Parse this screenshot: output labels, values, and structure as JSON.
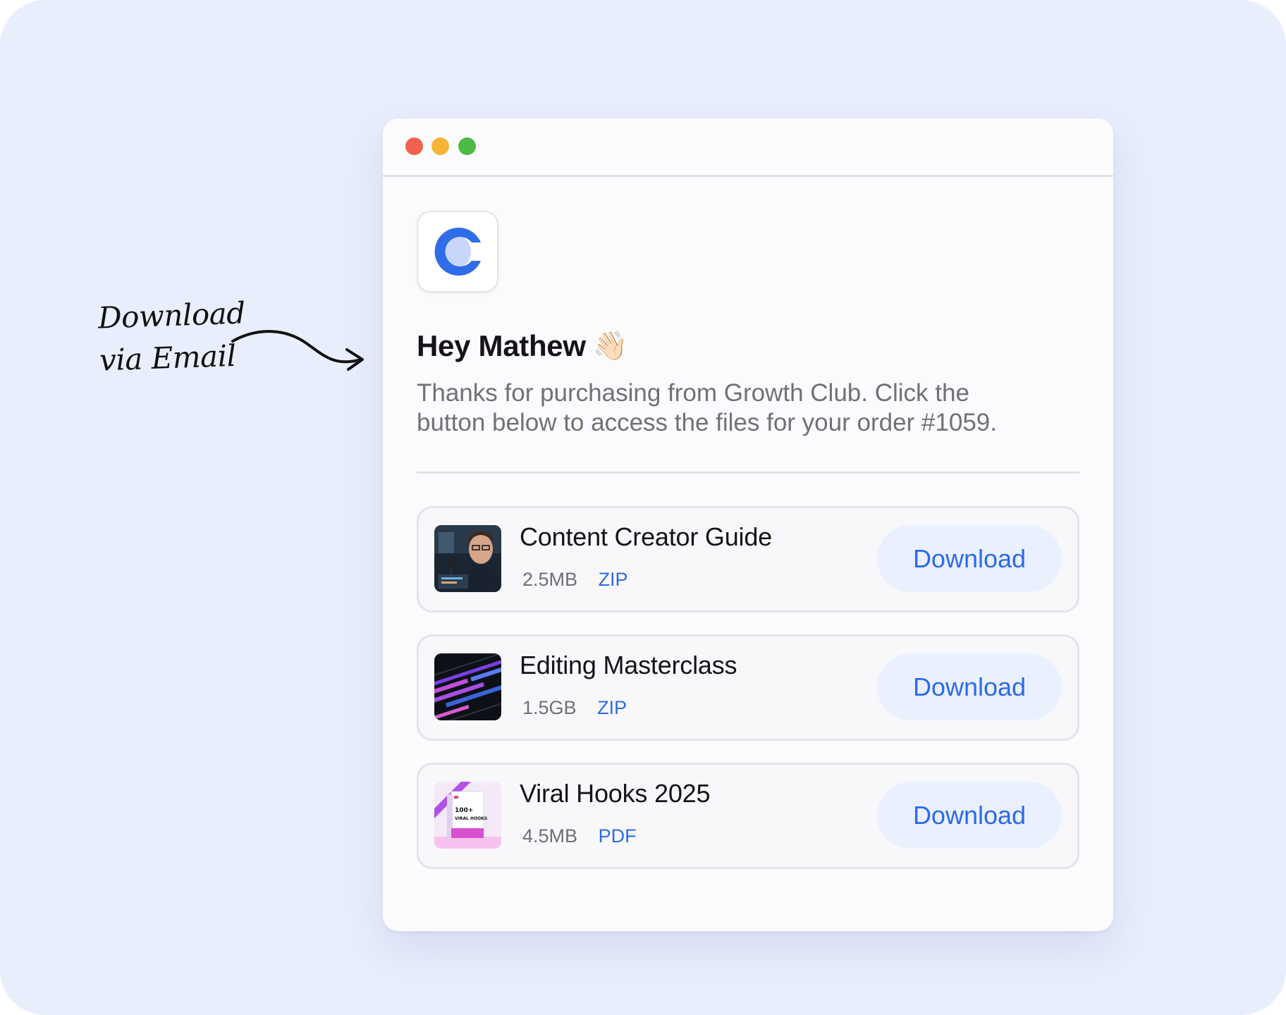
{
  "annotation": {
    "line1": "Download",
    "line2": "via Email"
  },
  "window": {
    "traffic_lights": [
      "close",
      "minimize",
      "zoom"
    ]
  },
  "email": {
    "logo_icon": "growth-club-logo-icon",
    "greeting": "Hey Mathew",
    "wave_emoji": "👋🏻",
    "message": "Thanks for purchasing from Growth Club. Click the button below to access the files for your order #1059."
  },
  "files": [
    {
      "title": "Content Creator Guide",
      "size": "2.5MB",
      "type": "ZIP",
      "button": "Download",
      "thumbnail": "podcast-creator-thumbnail"
    },
    {
      "title": "Editing Masterclass",
      "size": "1.5GB",
      "type": "ZIP",
      "button": "Download",
      "thumbnail": "editing-timeline-thumbnail"
    },
    {
      "title": "Viral Hooks 2025",
      "size": "4.5MB",
      "type": "PDF",
      "button": "Download",
      "thumbnail": "viral-hooks-book-thumbnail"
    }
  ],
  "colors": {
    "background": "#e9eefd",
    "accent": "#2d6ae6",
    "button_bg": "#eaf0fd",
    "dot_red": "#f2604f",
    "dot_yellow": "#f6b535",
    "dot_green": "#4dba45"
  }
}
